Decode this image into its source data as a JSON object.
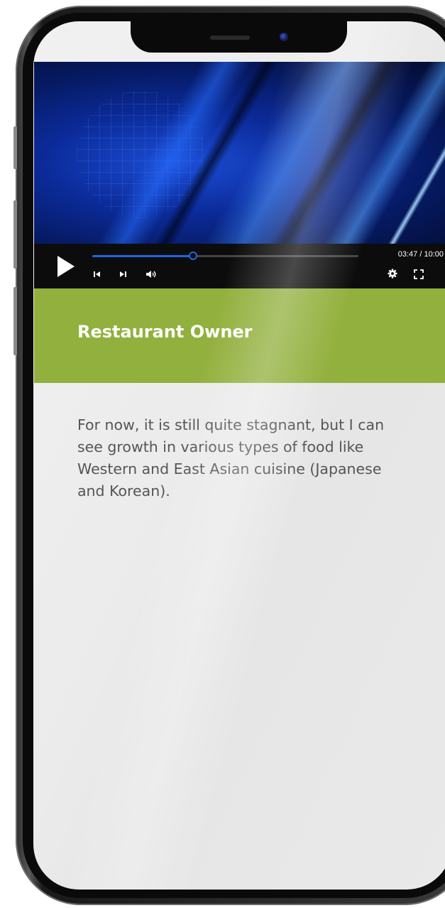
{
  "video_player": {
    "time_display": "03:47 / 10:00",
    "progress_fraction": 0.378,
    "accent_color": "#1d66e5",
    "icons": [
      "play-icon",
      "skip-back-icon",
      "skip-forward-icon",
      "volume-icon",
      "settings-icon",
      "fullscreen-icon"
    ]
  },
  "card": {
    "title": "Restaurant Owner",
    "band_color": "#92b03d",
    "quote": "For now, it is still quite stagnant, but I can see growth in various types of food like Western and East Asian cuisine (Japanese and Korean)."
  }
}
